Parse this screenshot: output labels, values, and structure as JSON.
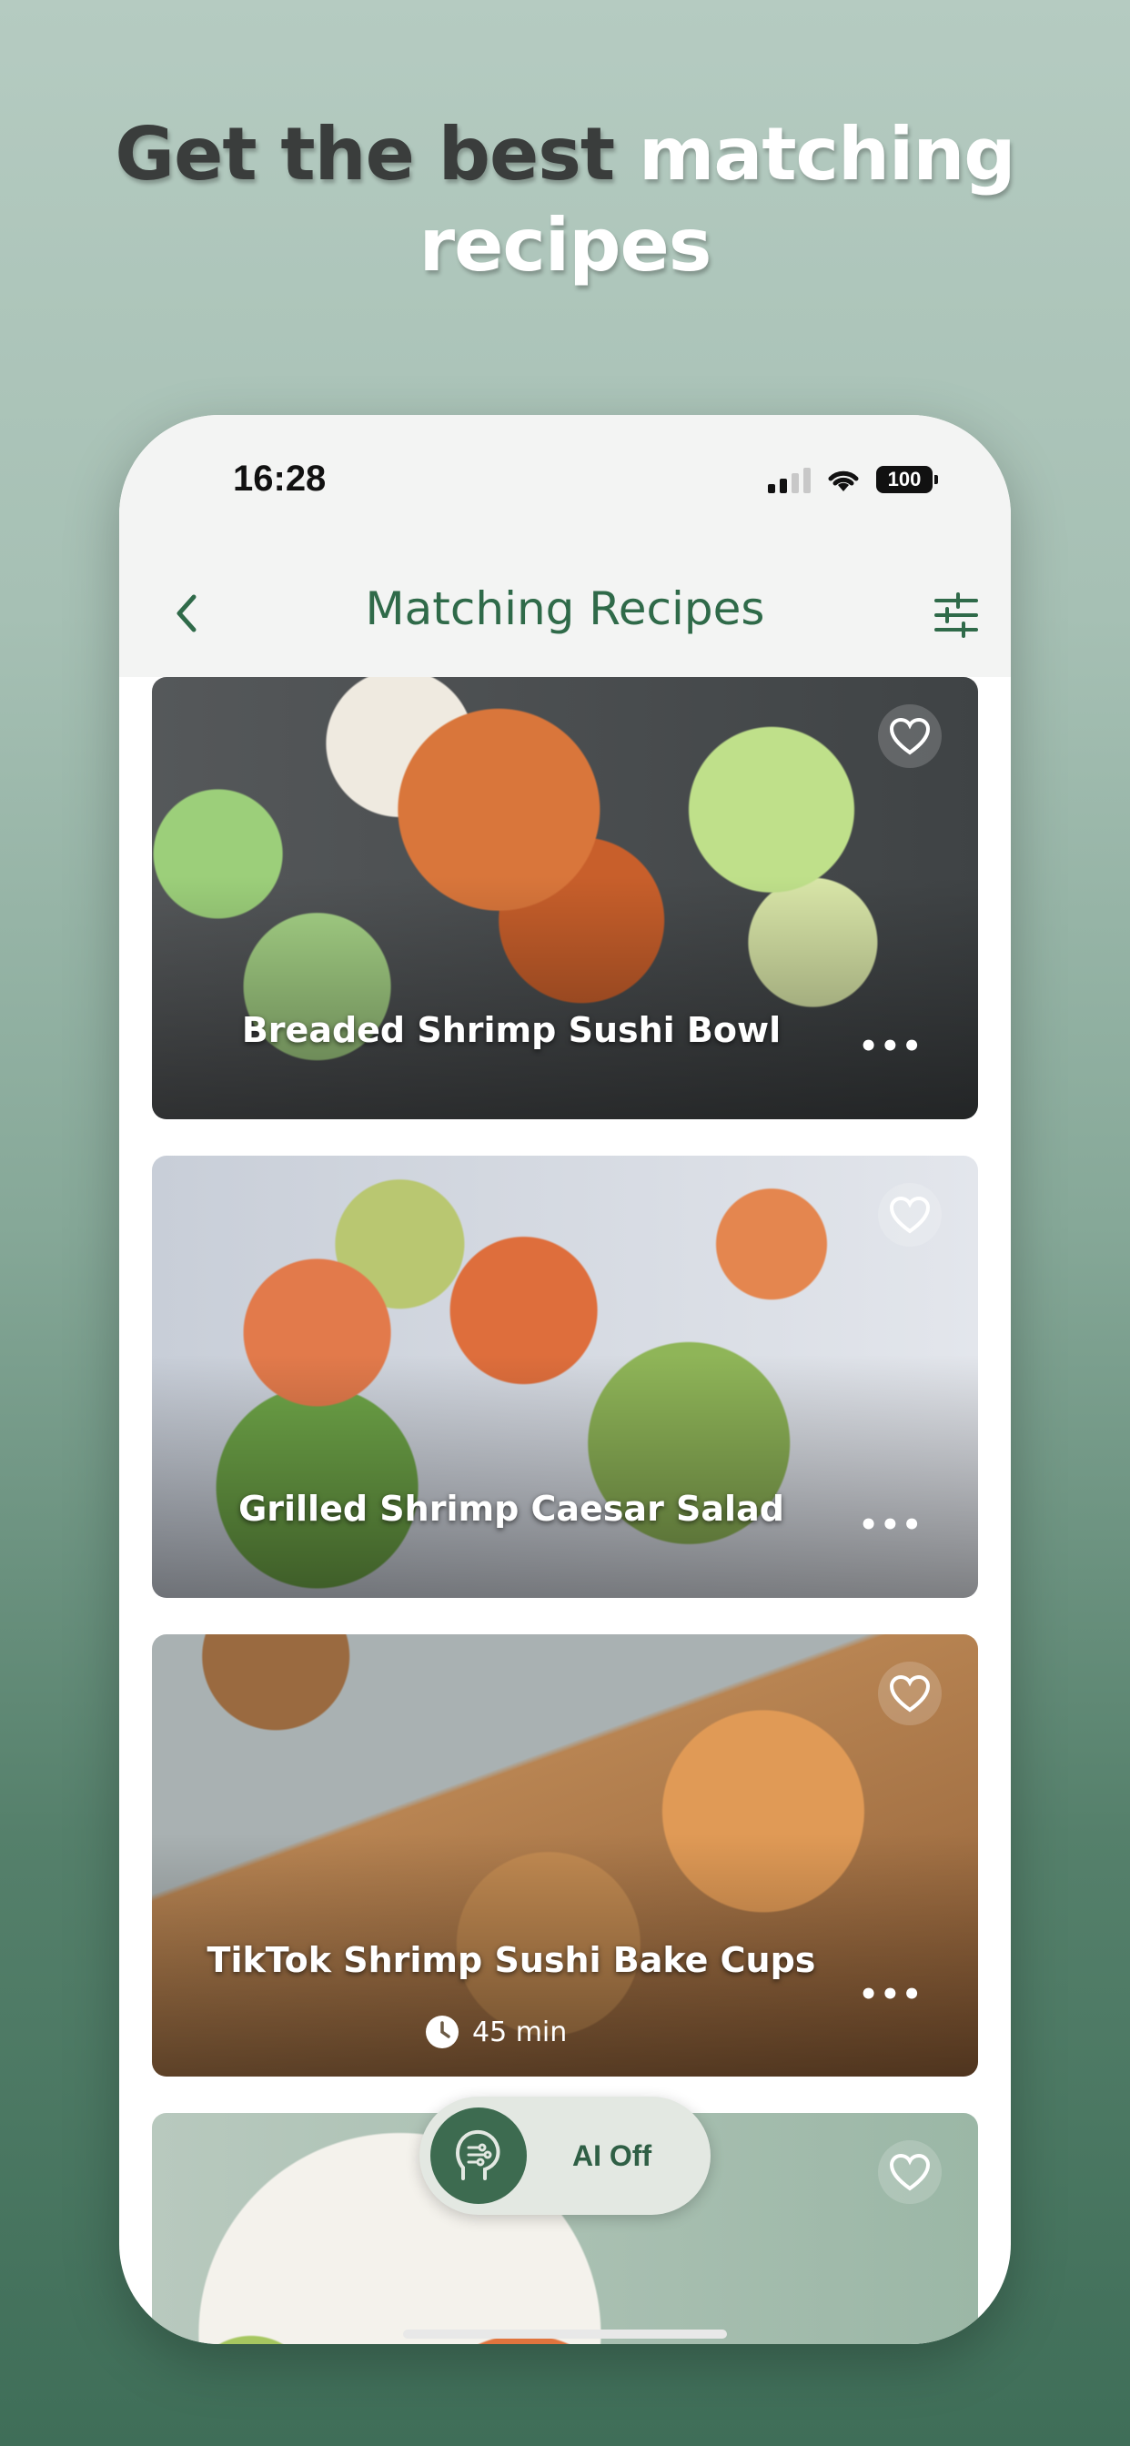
{
  "headline": {
    "part_dark": "Get the best",
    "part_light_1": "matching",
    "part_light_2": "recipes"
  },
  "status_bar": {
    "time": "16:28",
    "battery": "100"
  },
  "nav": {
    "title": "Matching Recipes"
  },
  "recipes": [
    {
      "title": "Breaded Shrimp Sushi Bowl",
      "more": "•••"
    },
    {
      "title": "Grilled Shrimp Caesar Salad",
      "more": "•••"
    },
    {
      "title": "TikTok Shrimp Sushi Bake Cups",
      "time": "45 min",
      "more": "•••"
    },
    {
      "title": ""
    }
  ],
  "ai_toggle": {
    "label": "AI Off"
  },
  "colors": {
    "accent": "#2f6a49",
    "pill_bg": "#e3e8e2",
    "ai_icon_bg": "#3d6b50"
  }
}
